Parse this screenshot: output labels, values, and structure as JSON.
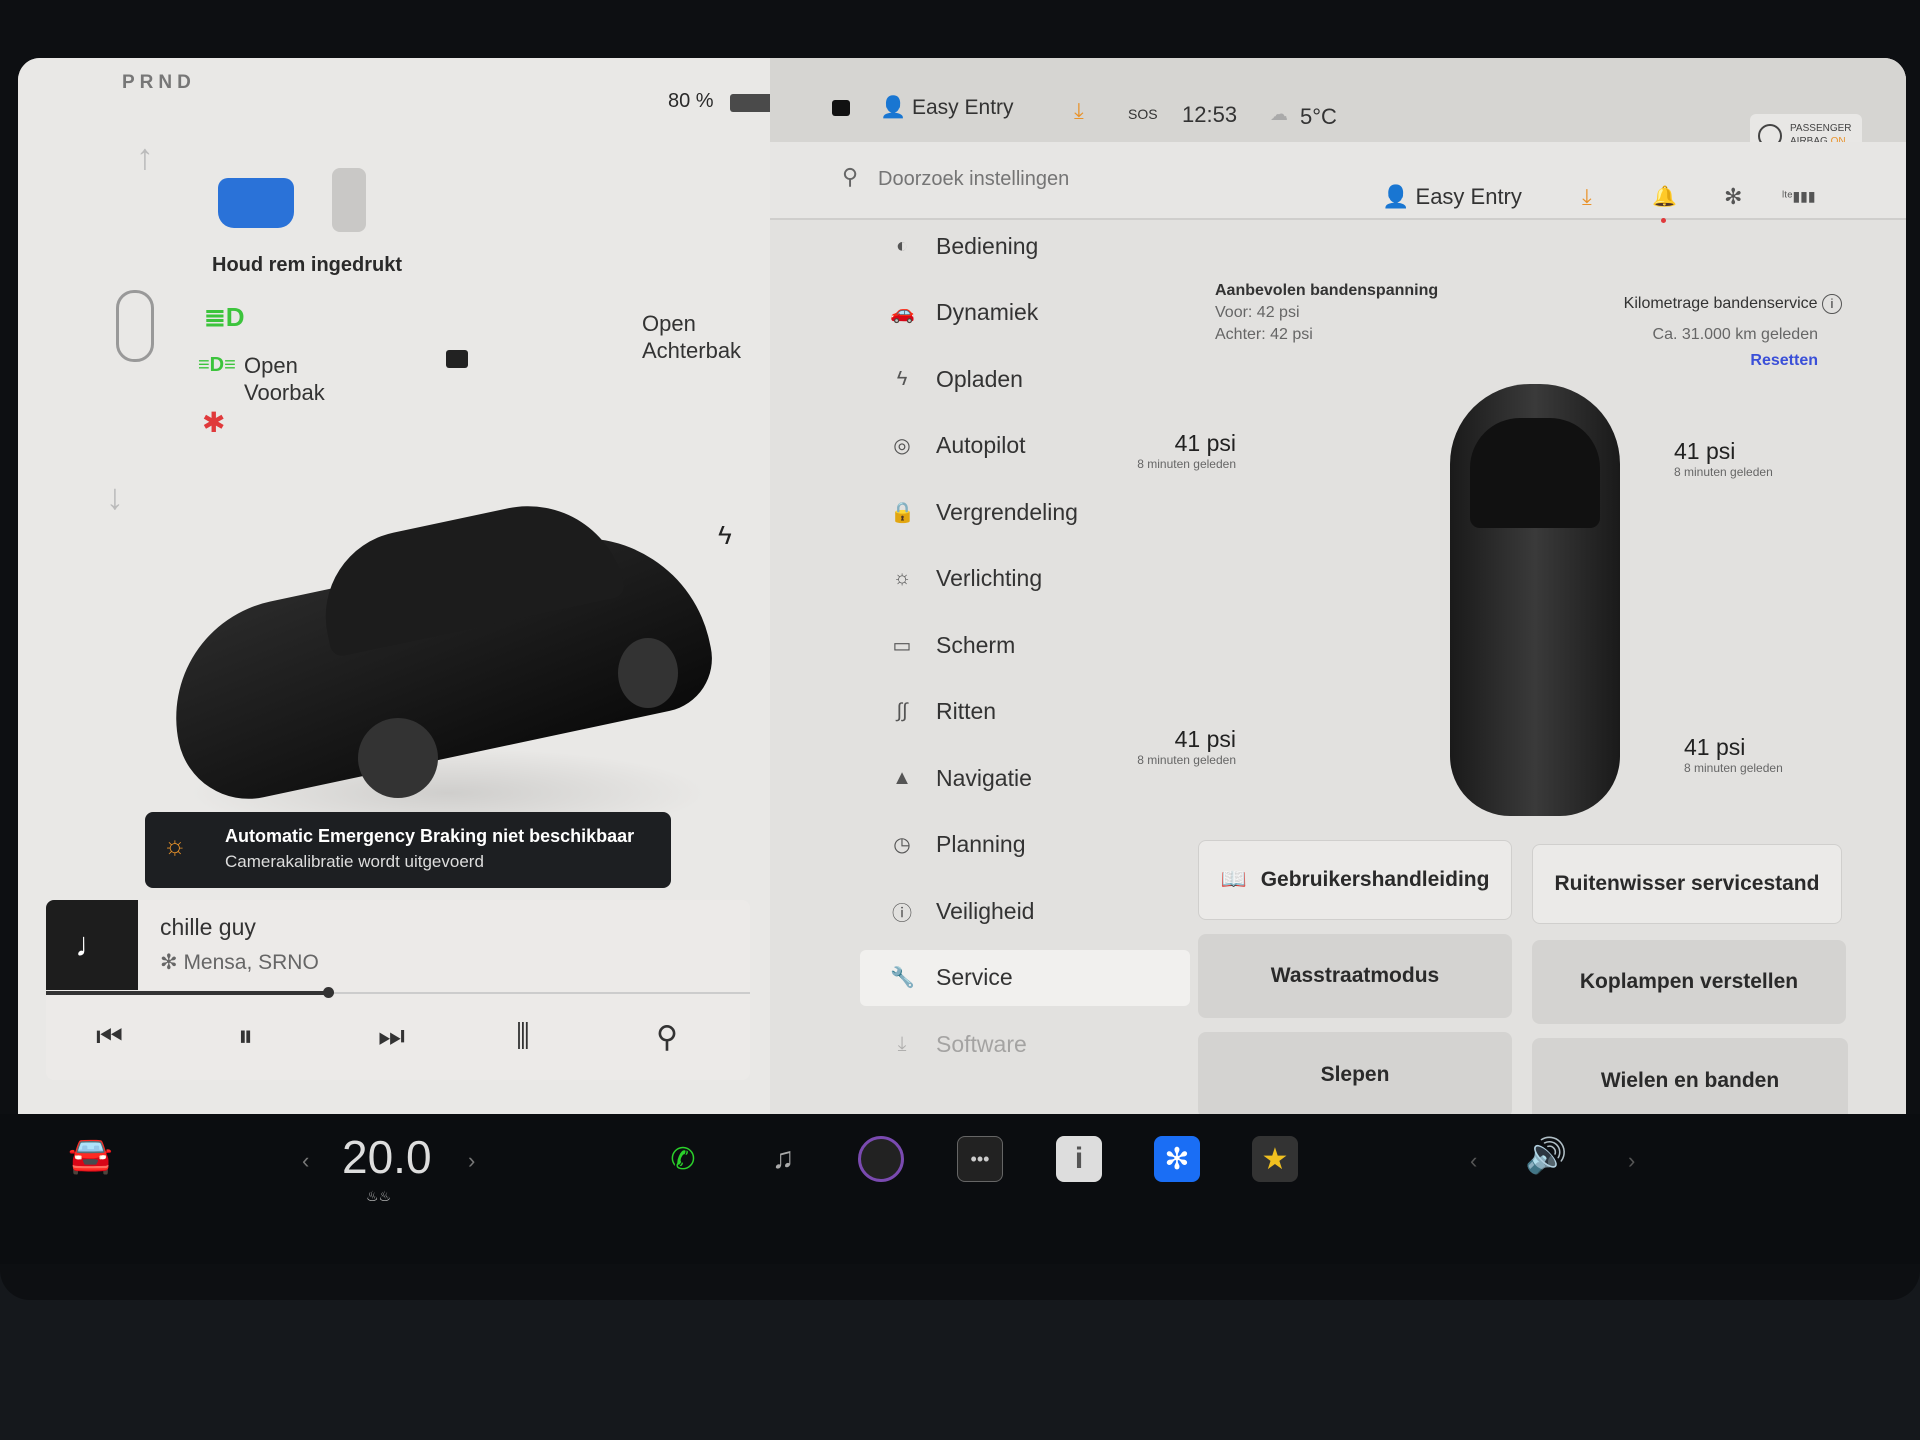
{
  "status_bar": {
    "gear": "PRND",
    "battery": "80 %",
    "profile": "Easy Entry",
    "sos": "SOS",
    "time": "12:53",
    "temperature": "5°C",
    "airbag_line1": "PASSENGER",
    "airbag_line2": "AIRBAG",
    "airbag_state": "ON"
  },
  "left_panel": {
    "brake_hint": "Houd rem ingedrukt",
    "frunk_label_1": "Open",
    "frunk_label_2": "Voorbak",
    "trunk_label_1": "Open",
    "trunk_label_2": "Achterbak",
    "alert": {
      "title": "Automatic Emergency Braking niet beschikbaar",
      "subtitle": "Camerakalibratie wordt uitgevoerd"
    },
    "media": {
      "title": "chille guy",
      "artist": "Mensa, SRNO",
      "progress": 0.4
    }
  },
  "settings": {
    "search_placeholder": "Doorzoek instellingen",
    "profile": "Easy Entry",
    "menu": [
      {
        "label": "Bediening",
        "icon": "toggle-icon"
      },
      {
        "label": "Dynamiek",
        "icon": "car-icon"
      },
      {
        "label": "Opladen",
        "icon": "bolt-icon"
      },
      {
        "label": "Autopilot",
        "icon": "steering-wheel-icon"
      },
      {
        "label": "Vergrendeling",
        "icon": "lock-icon"
      },
      {
        "label": "Verlichting",
        "icon": "sun-icon"
      },
      {
        "label": "Scherm",
        "icon": "display-icon"
      },
      {
        "label": "Ritten",
        "icon": "trips-icon"
      },
      {
        "label": "Navigatie",
        "icon": "navigation-icon"
      },
      {
        "label": "Planning",
        "icon": "clock-icon"
      },
      {
        "label": "Veiligheid",
        "icon": "alert-circle-icon"
      },
      {
        "label": "Service",
        "icon": "wrench-icon",
        "active": true
      },
      {
        "label": "Software",
        "icon": "download-icon"
      }
    ],
    "tire": {
      "recommended_title": "Aanbevolen bandenspanning",
      "front": "Voor: 42 psi",
      "rear": "Achter: 42 psi",
      "service_title": "Kilometrage bandenservice",
      "service_value": "Ca. 31.000 km geleden",
      "reset": "Resetten",
      "fl": {
        "value": "41 psi",
        "time": "8 minuten geleden"
      },
      "fr": {
        "value": "41 psi",
        "time": "8 minuten geleden"
      },
      "rl": {
        "value": "41 psi",
        "time": "8 minuten geleden"
      },
      "rr": {
        "value": "41 psi",
        "time": "8 minuten geleden"
      }
    },
    "buttons": [
      "Gebruikershandleiding",
      "Ruitenwisser servicestand",
      "Wasstraatmodus",
      "Koplampen verstellen",
      "Slepen",
      "Wielen en banden"
    ]
  },
  "dock": {
    "cabin_temp": "20.0",
    "icons": [
      "phone-icon",
      "music-icon",
      "camera-icon",
      "more-icon",
      "manual-icon",
      "bluetooth-icon",
      "games-icon"
    ]
  },
  "colors": {
    "accent_orange": "#e8922a",
    "link_blue": "#3a4fd8",
    "phone_green": "#2bd12b",
    "bluetooth_blue": "#1a6ef5",
    "headlight_green": "#3cc43c",
    "seatbelt_red": "#e0393b"
  }
}
